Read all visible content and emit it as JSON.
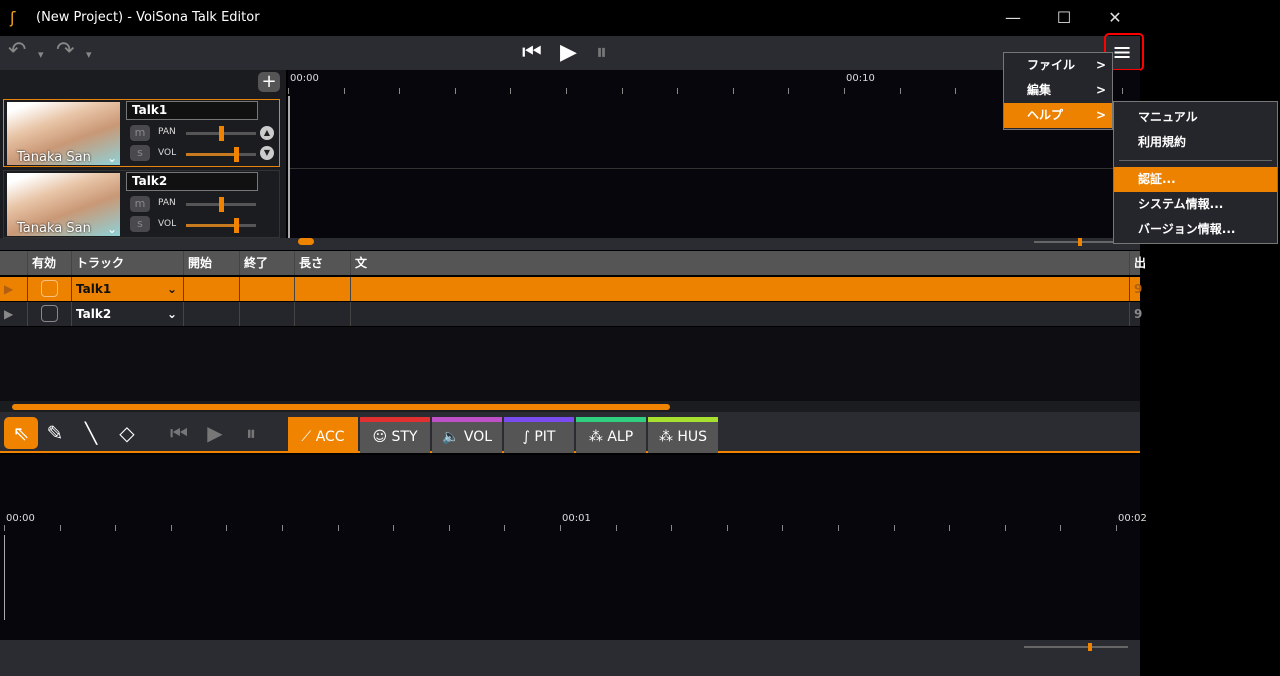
{
  "window": {
    "title": "(New Project) - VoiSona Talk Editor",
    "minimize": "—",
    "maximize": "☐",
    "close": "✕"
  },
  "toolbar": {
    "undo": "↶",
    "redo": "↷",
    "dropdown": "▾",
    "rewind": "⏮",
    "play": "▶",
    "pause": "⏸",
    "menu": "≡"
  },
  "ruler": {
    "labels": [
      "00:00",
      "00:10"
    ],
    "add": "+"
  },
  "tracks": [
    {
      "name": "Talk1",
      "voice": "Tanaka San",
      "mute": "m",
      "solo": "s",
      "pan_label": "PAN",
      "vol_label": "VOL",
      "pan": 0.5,
      "vol": 0.72
    },
    {
      "name": "Talk2",
      "voice": "Tanaka San",
      "mute": "m",
      "solo": "s",
      "pan_label": "PAN",
      "vol_label": "VOL",
      "pan": 0.5,
      "vol": 0.72
    }
  ],
  "table": {
    "headers": [
      "有効",
      "トラック",
      "開始",
      "終了",
      "長さ",
      "文",
      "出"
    ],
    "rows": [
      {
        "track": "Talk1",
        "extra": "9"
      },
      {
        "track": "Talk2",
        "extra": "9"
      }
    ]
  },
  "editor": {
    "tabs": [
      {
        "label": "ACC",
        "color": "#f08400"
      },
      {
        "label": "STY",
        "color": "#e03030"
      },
      {
        "label": "VOL",
        "color": "#c050c8"
      },
      {
        "label": "PIT",
        "color": "#7a4cf0"
      },
      {
        "label": "ALP",
        "color": "#30d080"
      },
      {
        "label": "HUS",
        "color": "#a8e030"
      }
    ],
    "ruler_labels": [
      "00:00",
      "00:01",
      "00:02"
    ]
  },
  "menu": {
    "items": [
      "ファイル",
      "編集",
      "ヘルプ"
    ],
    "chevron": ">",
    "help_submenu": [
      "マニュアル",
      "利用規約",
      "認証...",
      "システム情報...",
      "バージョン情報..."
    ]
  },
  "colors": {
    "accent": "#f08400",
    "highlight": "#ff0000"
  }
}
